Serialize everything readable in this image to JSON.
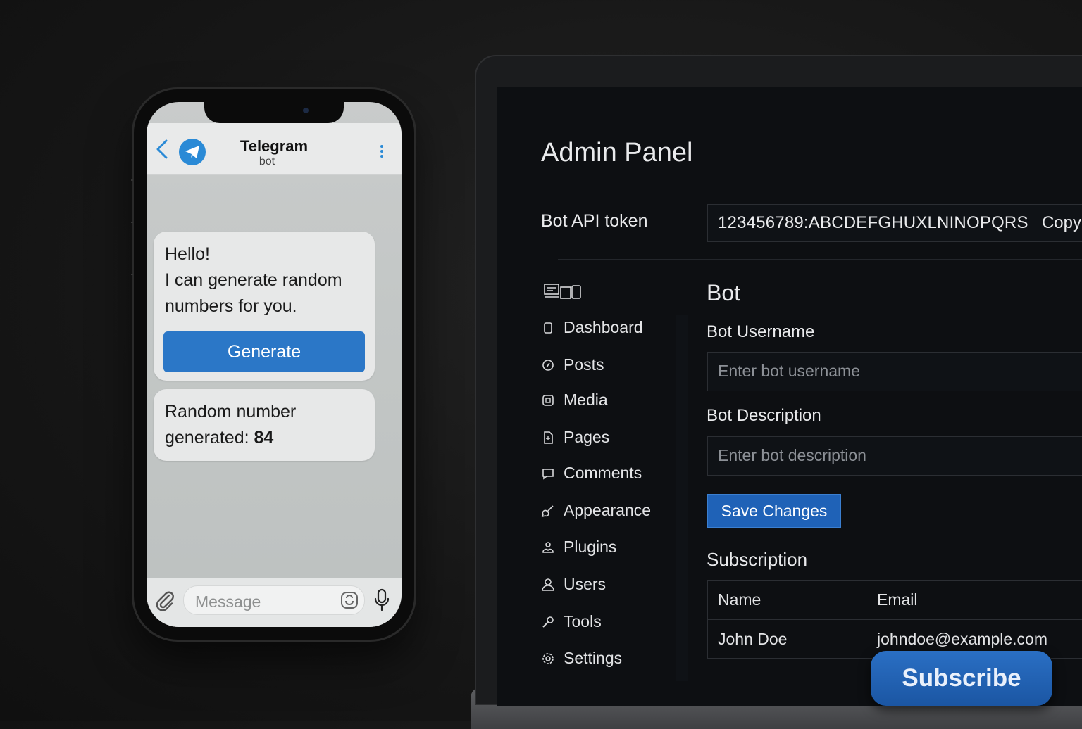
{
  "phone": {
    "header": {
      "title": "Telegram",
      "subtitle": "bot"
    },
    "messages": {
      "greeting_line1": "Hello!",
      "greeting_line2": "I can generate random",
      "greeting_line3": "numbers for you.",
      "generate_label": "Generate",
      "result_line1": "Random number",
      "result_prefix": "generated: ",
      "result_value": "84"
    },
    "input": {
      "placeholder": "Message"
    },
    "colors": {
      "accent": "#2b77c7",
      "logo": "#2a8ad6"
    }
  },
  "admin": {
    "title": "Admin Panel",
    "token_label": "Bot API token",
    "token_value": "123456789:ABCDEFGHUXLNINOPQRS",
    "copy_label": "Copy",
    "nav": [
      {
        "label": "Dashboard",
        "icon": "document-icon"
      },
      {
        "label": "Posts",
        "icon": "pin-icon"
      },
      {
        "label": "Media",
        "icon": "media-icon"
      },
      {
        "label": "Pages",
        "icon": "page-icon"
      },
      {
        "label": "Comments",
        "icon": "comment-icon"
      },
      {
        "label": "Appearance",
        "icon": "brush-icon"
      },
      {
        "label": "Plugins",
        "icon": "plugin-icon"
      },
      {
        "label": "Users",
        "icon": "user-icon"
      },
      {
        "label": "Tools",
        "icon": "wrench-icon"
      },
      {
        "label": "Settings",
        "icon": "gear-icon"
      }
    ],
    "section_title": "Bot",
    "username_label": "Bot Username",
    "username_placeholder": "Enter bot username",
    "description_label": "Bot Description",
    "description_placeholder": "Enter bot description",
    "save_label": "Save Changes",
    "subscription_title": "Subscription",
    "table": {
      "headers": [
        "Name",
        "Email"
      ],
      "rows": [
        [
          "John Doe",
          "johndoe@example.com"
        ]
      ]
    },
    "colors": {
      "primary": "#1f62b7",
      "background": "#0d0f12"
    }
  },
  "subscribe_label": "Subscribe"
}
